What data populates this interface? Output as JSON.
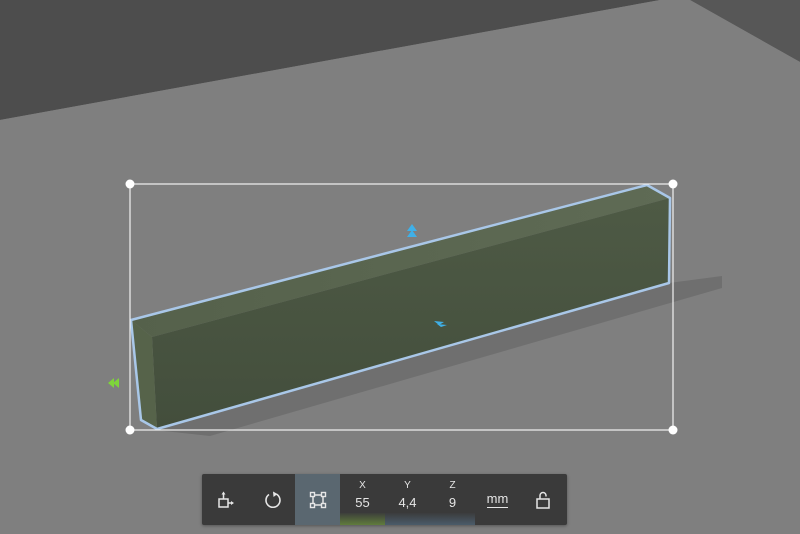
{
  "scene": {
    "colors": {
      "floor": "#7f7f7f",
      "background_dark": "#4d4d4d",
      "object_top": "#59654f",
      "object_front": "#4a5642",
      "object_end": "#56634a",
      "selection_outline": "#a9c7e8",
      "bounding_box": "#ffffff",
      "handle_blue": "#3fb0e8",
      "handle_green": "#7ed43a"
    },
    "selected_object": "box"
  },
  "toolbar": {
    "tools": [
      {
        "name": "move-tool",
        "icon": "move-icon"
      },
      {
        "name": "rotate-tool",
        "icon": "rotate-icon"
      },
      {
        "name": "scale-tool",
        "icon": "scale-icon",
        "active": true
      }
    ],
    "dimensions": [
      {
        "axis": "X",
        "value": "55",
        "bar_color": "#607c3c"
      },
      {
        "axis": "Y",
        "value": "4,4",
        "bar_color": "#4b5c6a"
      },
      {
        "axis": "Z",
        "value": "9",
        "bar_color": "#4b5c6a"
      }
    ],
    "unit": "mm",
    "lock_icon": "unlock-icon"
  }
}
